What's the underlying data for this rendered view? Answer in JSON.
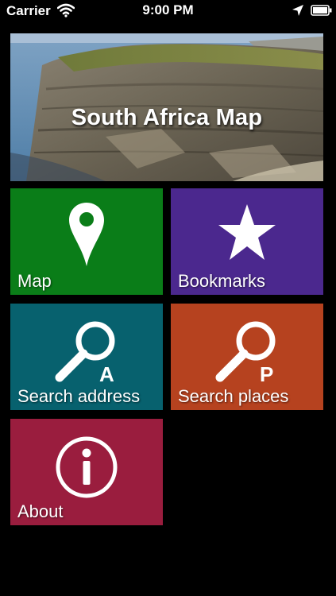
{
  "status_bar": {
    "carrier": "Carrier",
    "time": "9:00 PM",
    "icons": [
      "wifi-icon",
      "location-arrow-icon",
      "battery-icon"
    ]
  },
  "hero": {
    "title": "South Africa Map",
    "image": "coastal-cliff-photo"
  },
  "tiles": [
    {
      "label": "Map",
      "icon": "map-pin-icon",
      "color": "#0a7d18"
    },
    {
      "label": "Bookmarks",
      "icon": "star-icon",
      "color": "#4b288e"
    },
    {
      "label": "Search address",
      "icon": "search-address-icon",
      "icon_letter": "A",
      "color": "#07616e"
    },
    {
      "label": "Search places",
      "icon": "search-places-icon",
      "icon_letter": "P",
      "color": "#b6421f"
    },
    {
      "label": "About",
      "icon": "info-icon",
      "color": "#9a1d3e"
    }
  ]
}
